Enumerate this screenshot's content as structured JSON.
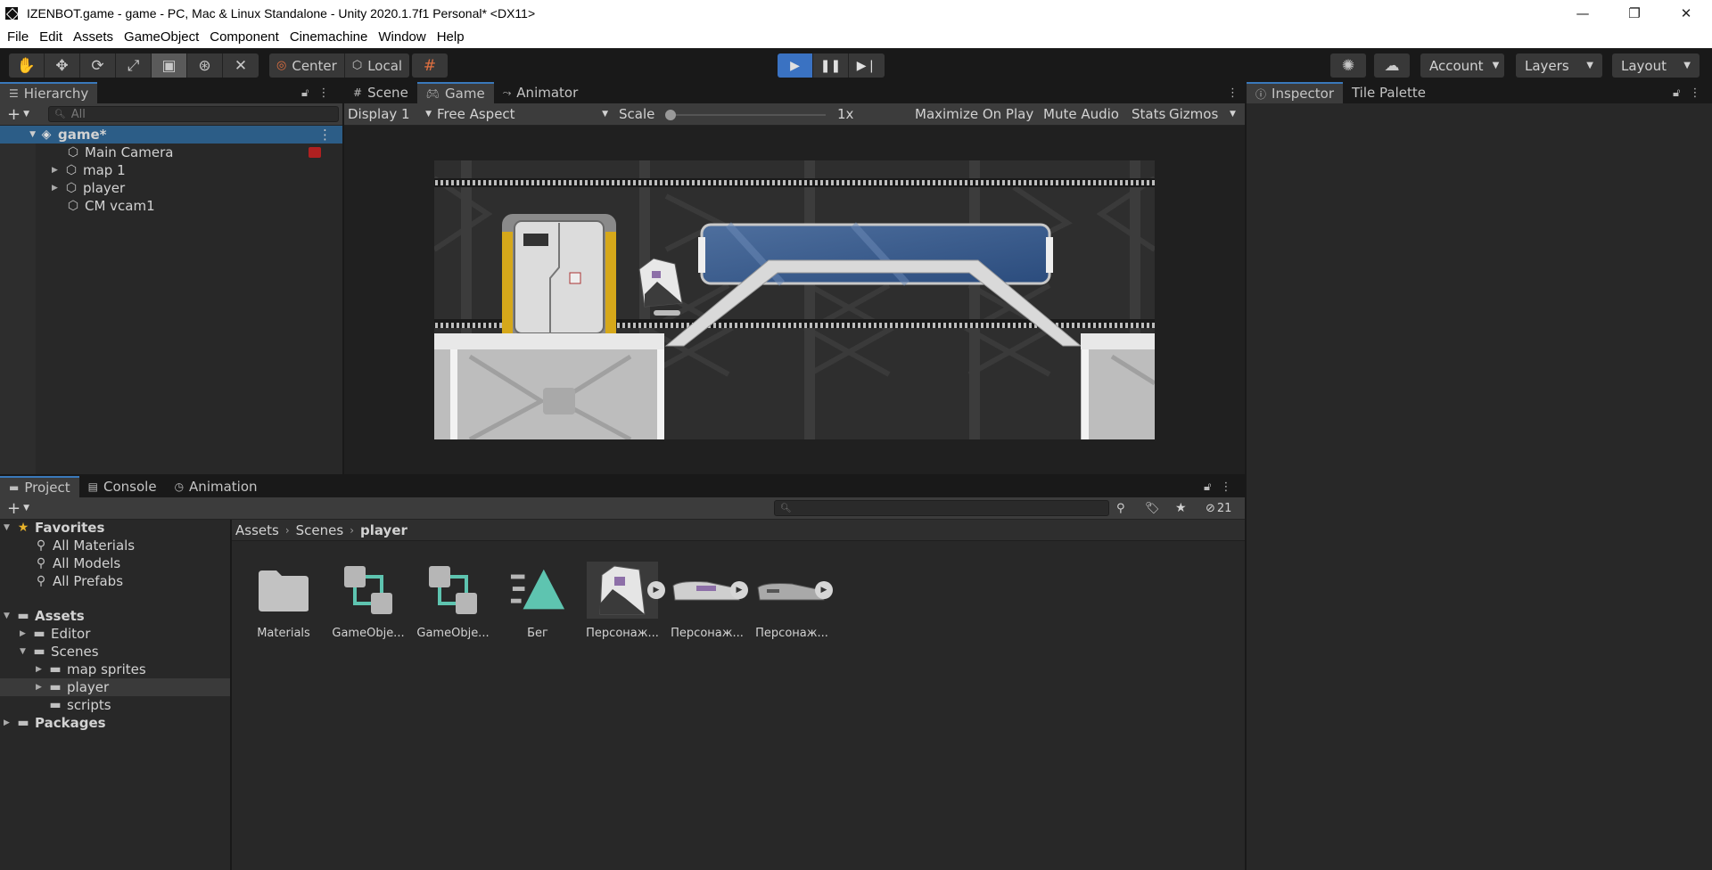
{
  "window": {
    "title": "IZENBOT.game - game - PC, Mac & Linux Standalone - Unity 2020.1.7f1 Personal* <DX11>",
    "controls": [
      "—",
      "❐",
      "✕"
    ]
  },
  "menu": [
    "File",
    "Edit",
    "Assets",
    "GameObject",
    "Component",
    "Cinemachine",
    "Window",
    "Help"
  ],
  "toolbar": {
    "pivot_label": "Center",
    "space_label": "Local",
    "account_label": "Account",
    "layers_label": "Layers",
    "layout_label": "Layout"
  },
  "hierarchy": {
    "tab": "Hierarchy",
    "search_placeholder": "All",
    "scene": "game*",
    "items": [
      "Main Camera",
      "map 1",
      "player",
      "CM vcam1"
    ]
  },
  "center_tabs": [
    "Scene",
    "Game",
    "Animator"
  ],
  "game": {
    "display": "Display 1",
    "aspect": "Free Aspect",
    "scale_label": "Scale",
    "scale_value": "1x",
    "scale_fraction": 0.0,
    "maximize": "Maximize On Play",
    "mute": "Mute Audio",
    "stats": "Stats",
    "gizmos": "Gizmos"
  },
  "inspector_tabs": [
    "Inspector",
    "Tile Palette"
  ],
  "bottom_tabs": [
    "Project",
    "Console",
    "Animation"
  ],
  "project": {
    "hidden_count": "21",
    "favorites_label": "Favorites",
    "favorites": [
      "All Materials",
      "All Models",
      "All Prefabs"
    ],
    "assets_label": "Assets",
    "tree": [
      "Editor",
      "Scenes",
      "map sprites",
      "player",
      "scripts"
    ],
    "packages_label": "Packages",
    "breadcrumb": [
      "Assets",
      "Scenes",
      "player"
    ],
    "assets": [
      "Materials",
      "GameObje...",
      "GameObje...",
      "Бег",
      "Персонаж...",
      "Персонаж...",
      "Персонаж..."
    ]
  },
  "colors": {
    "accent": "#3a79bb",
    "play_active": "#3a72c2",
    "selection": "#2c5d87",
    "teal": "#5ec4b0"
  }
}
